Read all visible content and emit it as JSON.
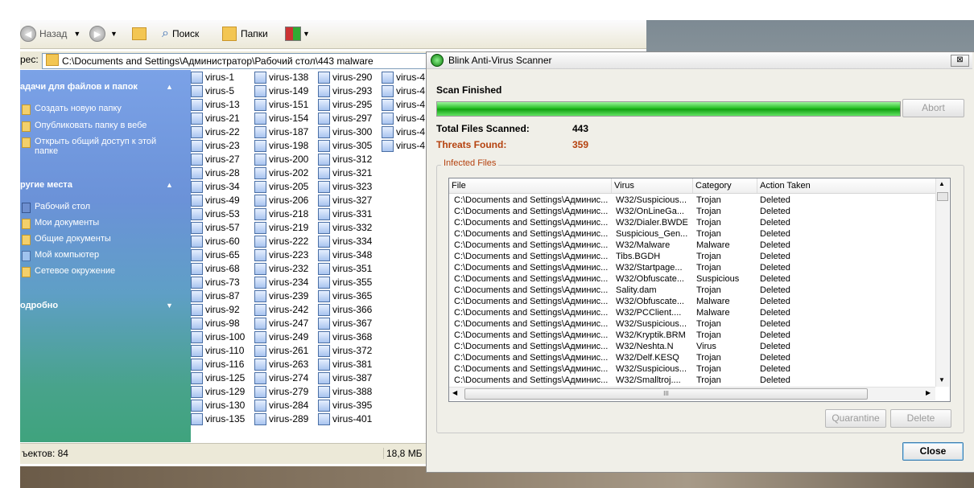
{
  "toolbar": {
    "back": "Назад",
    "search": "Поиск",
    "folders": "Папки"
  },
  "address": {
    "label": "рес:",
    "path": "C:\\Documents and Settings\\Администратор\\Рабочий стол\\443 malware"
  },
  "taskpane": {
    "tasks_title": "адачи для файлов и папок",
    "tasks": [
      "Создать новую папку",
      "Опубликовать папку в вебе",
      "Открыть общий доступ к этой папке"
    ],
    "places_title": "ругие места",
    "places": [
      "Рабочий стол",
      "Мои документы",
      "Общие документы",
      "Мой компьютер",
      "Сетевое окружение"
    ],
    "details_title": "одробно"
  },
  "files": {
    "col1": [
      "virus-1",
      "virus-5",
      "virus-13",
      "virus-21",
      "virus-22",
      "virus-23",
      "virus-27",
      "virus-28",
      "virus-34",
      "virus-49",
      "virus-53",
      "virus-57",
      "virus-60",
      "virus-65",
      "virus-68",
      "virus-73",
      "virus-87",
      "virus-92",
      "virus-98",
      "virus-100",
      "virus-110",
      "virus-116",
      "virus-125",
      "virus-129",
      "virus-130",
      "virus-135"
    ],
    "col2": [
      "virus-138",
      "virus-149",
      "virus-151",
      "virus-154",
      "virus-187",
      "virus-198",
      "virus-200",
      "virus-202",
      "virus-205",
      "virus-206",
      "virus-218",
      "virus-219",
      "virus-222",
      "virus-223",
      "virus-232",
      "virus-234",
      "virus-239",
      "virus-242",
      "virus-247",
      "virus-249",
      "virus-261",
      "virus-263",
      "virus-274",
      "virus-279",
      "virus-284",
      "virus-289"
    ],
    "col3": [
      "virus-290",
      "virus-293",
      "virus-295",
      "virus-297",
      "virus-300",
      "virus-305",
      "virus-312",
      "virus-321",
      "virus-323",
      "virus-327",
      "virus-331",
      "virus-332",
      "virus-334",
      "virus-348",
      "virus-351",
      "virus-355",
      "virus-365",
      "virus-366",
      "virus-367",
      "virus-368",
      "virus-372",
      "virus-381",
      "virus-387",
      "virus-388",
      "virus-395",
      "virus-401"
    ],
    "col4": [
      "virus-4",
      "virus-4",
      "virus-4",
      "virus-4",
      "virus-4",
      "virus-4"
    ]
  },
  "status": {
    "objects": "ъектов: 84",
    "size": "18,8 МБ"
  },
  "scanner": {
    "title": "Blink Anti-Virus Scanner",
    "close_x": "⊠",
    "scan_status": "Scan Finished",
    "progress_fraction": 1.0,
    "abort_label": "Abort",
    "total_label": "Total Files Scanned:",
    "total_value": "443",
    "threats_label": "Threats Found:",
    "threats_value": "359",
    "group_label": "Infected Files",
    "columns": [
      "File",
      "Virus",
      "Category",
      "Action Taken"
    ],
    "rows": [
      [
        "C:\\Documents and Settings\\Админис...",
        "W32/Suspicious...",
        "Trojan",
        "Deleted"
      ],
      [
        "C:\\Documents and Settings\\Админис...",
        "W32/OnLineGa...",
        "Trojan",
        "Deleted"
      ],
      [
        "C:\\Documents and Settings\\Админис...",
        "W32/Dialer.BWDE",
        "Trojan",
        "Deleted"
      ],
      [
        "C:\\Documents and Settings\\Админис...",
        "Suspicious_Gen...",
        "Trojan",
        "Deleted"
      ],
      [
        "C:\\Documents and Settings\\Админис...",
        "W32/Malware",
        "Malware",
        "Deleted"
      ],
      [
        "C:\\Documents and Settings\\Админис...",
        "Tibs.BGDH",
        "Trojan",
        "Deleted"
      ],
      [
        "C:\\Documents and Settings\\Админис...",
        "W32/Startpage...",
        "Trojan",
        "Deleted"
      ],
      [
        "C:\\Documents and Settings\\Админис...",
        "W32/Obfuscate...",
        "Suspicious",
        "Deleted"
      ],
      [
        "C:\\Documents and Settings\\Админис...",
        "Sality.dam",
        "Trojan",
        "Deleted"
      ],
      [
        "C:\\Documents and Settings\\Админис...",
        "W32/Obfuscate...",
        "Malware",
        "Deleted"
      ],
      [
        "C:\\Documents and Settings\\Админис...",
        "W32/PCClient....",
        "Malware",
        "Deleted"
      ],
      [
        "C:\\Documents and Settings\\Админис...",
        "W32/Suspicious...",
        "Trojan",
        "Deleted"
      ],
      [
        "C:\\Documents and Settings\\Админис...",
        "W32/Kryptik.BRM",
        "Trojan",
        "Deleted"
      ],
      [
        "C:\\Documents and Settings\\Админис...",
        "W32/Neshta.N",
        "Virus",
        "Deleted"
      ],
      [
        "C:\\Documents and Settings\\Админис...",
        "W32/Delf.KESQ",
        "Trojan",
        "Deleted"
      ],
      [
        "C:\\Documents and Settings\\Админис...",
        "W32/Suspicious...",
        "Trojan",
        "Deleted"
      ],
      [
        "C:\\Documents and Settings\\Админис...",
        "W32/Smalltroj....",
        "Trojan",
        "Deleted"
      ]
    ],
    "hscroll_grip": "III",
    "quarantine_label": "Quarantine",
    "delete_label": "Delete",
    "close_label": "Close",
    "colors": {
      "threat": "#b5420f",
      "progress": "#16b916"
    }
  }
}
